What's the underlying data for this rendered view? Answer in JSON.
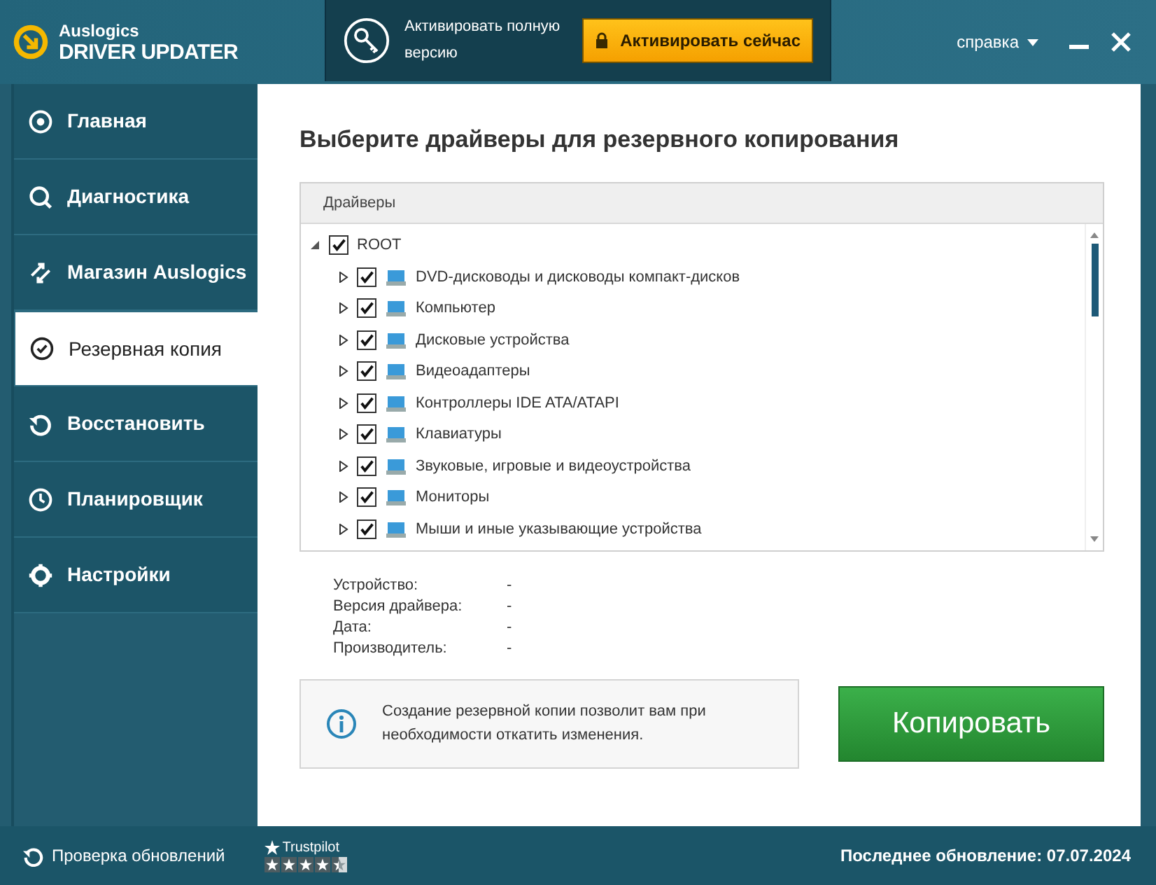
{
  "header": {
    "brand_top": "Auslogics",
    "brand_main": "DRIVER UPDATER",
    "promo_text": "Активировать полную версию",
    "activate_button": "Активировать сейчас",
    "help_menu": "справка"
  },
  "sidebar": {
    "items": [
      {
        "label": "Главная",
        "selected": false
      },
      {
        "label": "Диагностика",
        "selected": false
      },
      {
        "label": "Магазин Auslogics",
        "selected": false
      },
      {
        "label": "Резервная копия",
        "selected": true
      },
      {
        "label": "Восстановить",
        "selected": false
      },
      {
        "label": "Планировщик",
        "selected": false
      },
      {
        "label": "Настройки",
        "selected": false
      }
    ]
  },
  "content": {
    "title": "Выберите драйверы для резервного копирования",
    "tree": {
      "column": "Драйверы",
      "root": {
        "label": "ROOT",
        "expanded": true,
        "checked": true,
        "children": [
          {
            "label": "DVD-дисководы и дисководы компакт-дисков",
            "expanded": false,
            "checked": true
          },
          {
            "label": "Компьютер",
            "expanded": false,
            "checked": true
          },
          {
            "label": "Дисковые устройства",
            "expanded": false,
            "checked": true
          },
          {
            "label": "Видеоадаптеры",
            "expanded": false,
            "checked": true
          },
          {
            "label": "Контроллеры IDE ATA/ATAPI",
            "expanded": false,
            "checked": true
          },
          {
            "label": "Клавиатуры",
            "expanded": false,
            "checked": true
          },
          {
            "label": "Звуковые, игровые и видеоустройства",
            "expanded": false,
            "checked": true
          },
          {
            "label": "Мониторы",
            "expanded": false,
            "checked": true
          },
          {
            "label": "Мыши и иные указывающие устройства",
            "expanded": false,
            "checked": true
          }
        ]
      }
    },
    "details": [
      {
        "label": "Устройство:",
        "value": "-"
      },
      {
        "label": "Версия драйвера:",
        "value": "-"
      },
      {
        "label": "Дата:",
        "value": "-"
      },
      {
        "label": "Производитель:",
        "value": "-"
      }
    ],
    "info": "Создание резервной копии позволит вам при необходимости откатить изменения.",
    "copy_button": "Копировать"
  },
  "footer": {
    "check_updates": "Проверка обновлений",
    "trustpilot": {
      "label": "Trustpilot",
      "stars": 4.5
    },
    "last_update": "Последнее обновление: 07.07.2024"
  }
}
